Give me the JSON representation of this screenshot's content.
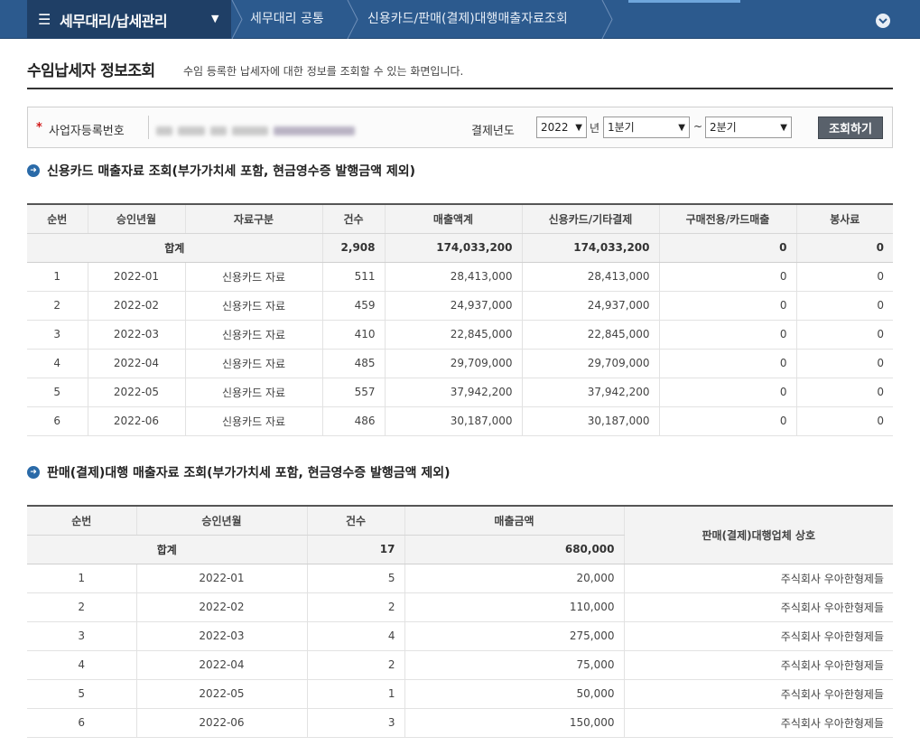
{
  "nav": {
    "menu_icon": "☰",
    "menu_title": "세무대리/납세관리",
    "crumbs": [
      "세무대리 공통",
      "신용카드/판매(결제)대행매출자료조회"
    ]
  },
  "page": {
    "title": "수임납세자 정보조회",
    "desc": "수임 등록한 납세자에 대한 정보를 조회할 수 있는 화면입니다."
  },
  "search": {
    "biz_label": "사업자등록번호",
    "year_label": "결제년도",
    "year": "2022",
    "year_unit": "년",
    "from_quarter": "1분기",
    "tilde": "~",
    "to_quarter": "2분기",
    "button": "조회하기"
  },
  "card": {
    "title": "신용카드 매출자료 조회(부가가치세 포함, 현금영수증 발행금액 제외)",
    "headers": [
      "순번",
      "승인년월",
      "자료구분",
      "건수",
      "매출액계",
      "신용카드/기타결제",
      "구매전용/카드매출",
      "봉사료"
    ],
    "total": {
      "label": "합계",
      "count": "2,908",
      "sales": "174,033,200",
      "card": "174,033,200",
      "purchase": "0",
      "service": "0"
    },
    "rows": [
      {
        "no": "1",
        "month": "2022-01",
        "type": "신용카드 자료",
        "count": "511",
        "sales": "28,413,000",
        "card": "28,413,000",
        "purchase": "0",
        "service": "0"
      },
      {
        "no": "2",
        "month": "2022-02",
        "type": "신용카드 자료",
        "count": "459",
        "sales": "24,937,000",
        "card": "24,937,000",
        "purchase": "0",
        "service": "0"
      },
      {
        "no": "3",
        "month": "2022-03",
        "type": "신용카드 자료",
        "count": "410",
        "sales": "22,845,000",
        "card": "22,845,000",
        "purchase": "0",
        "service": "0"
      },
      {
        "no": "4",
        "month": "2022-04",
        "type": "신용카드 자료",
        "count": "485",
        "sales": "29,709,000",
        "card": "29,709,000",
        "purchase": "0",
        "service": "0"
      },
      {
        "no": "5",
        "month": "2022-05",
        "type": "신용카드 자료",
        "count": "557",
        "sales": "37,942,200",
        "card": "37,942,200",
        "purchase": "0",
        "service": "0"
      },
      {
        "no": "6",
        "month": "2022-06",
        "type": "신용카드 자료",
        "count": "486",
        "sales": "30,187,000",
        "card": "30,187,000",
        "purchase": "0",
        "service": "0"
      }
    ]
  },
  "agency": {
    "title": "판매(결제)대행 매출자료 조회(부가가치세 포함, 현금영수증 발행금액 제외)",
    "headers": [
      "순번",
      "승인년월",
      "건수",
      "매출금액",
      "판매(결제)대행업체 상호"
    ],
    "total": {
      "label": "합계",
      "count": "17",
      "amount": "680,000"
    },
    "rows": [
      {
        "no": "1",
        "month": "2022-01",
        "count": "5",
        "amount": "20,000",
        "company": "주식회사 우아한형제들"
      },
      {
        "no": "2",
        "month": "2022-02",
        "count": "2",
        "amount": "110,000",
        "company": "주식회사 우아한형제들"
      },
      {
        "no": "3",
        "month": "2022-03",
        "count": "4",
        "amount": "275,000",
        "company": "주식회사 우아한형제들"
      },
      {
        "no": "4",
        "month": "2022-04",
        "count": "2",
        "amount": "75,000",
        "company": "주식회사 우아한형제들"
      },
      {
        "no": "5",
        "month": "2022-05",
        "count": "1",
        "amount": "50,000",
        "company": "주식회사 우아한형제들"
      },
      {
        "no": "6",
        "month": "2022-06",
        "count": "3",
        "amount": "150,000",
        "company": "주식회사 우아한형제들"
      }
    ]
  }
}
